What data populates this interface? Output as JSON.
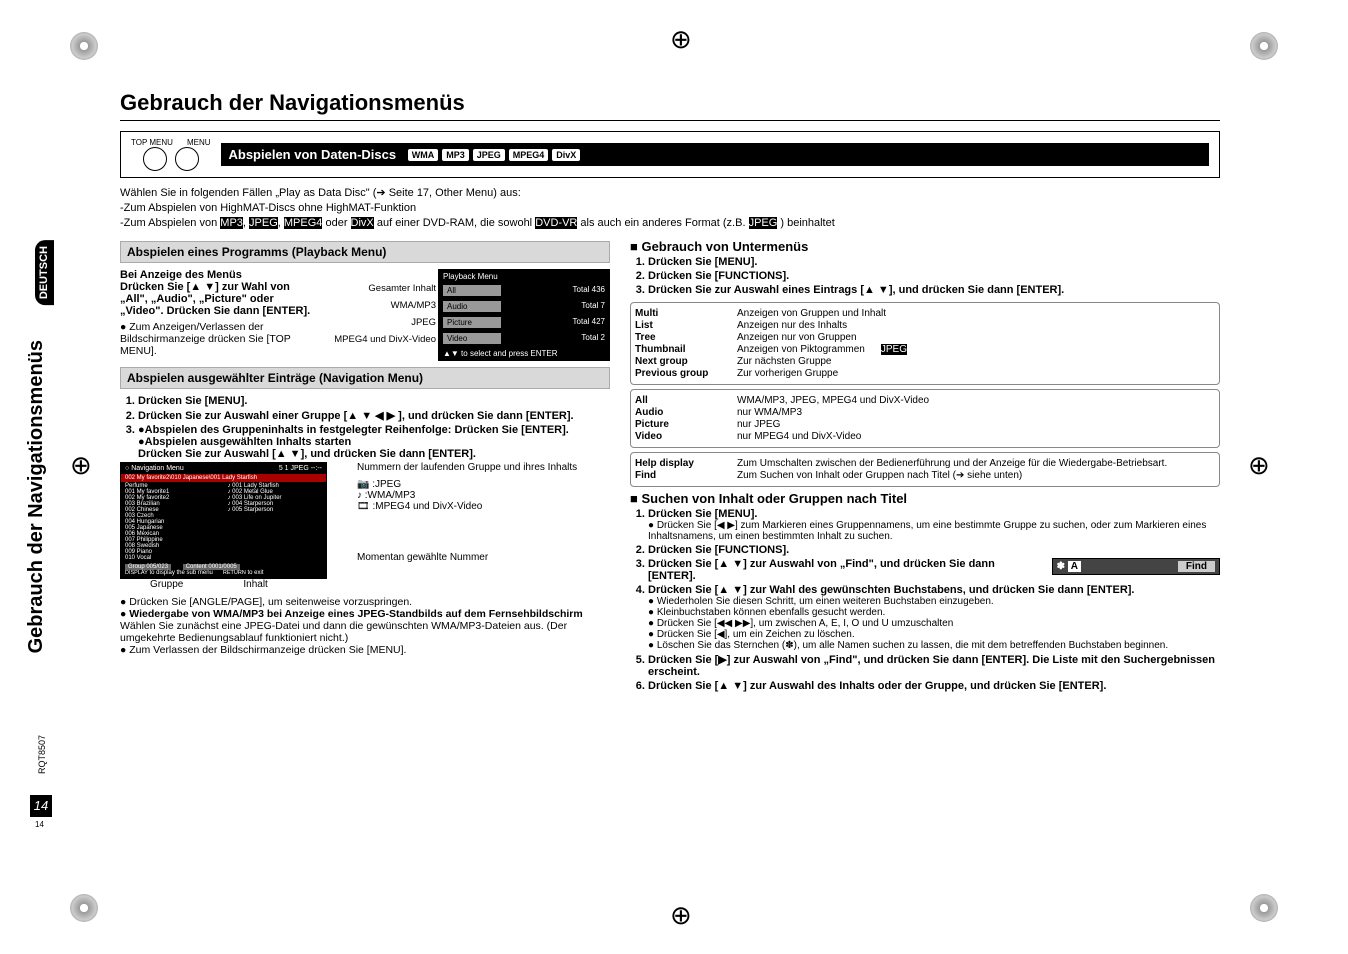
{
  "header": {
    "title": "Gebrauch der Navigationsmenüs",
    "strip": "Abspielen von Daten-Discs",
    "tags": [
      "WMA",
      "MP3",
      "JPEG",
      "MPEG4",
      "DivX"
    ],
    "topmenu": "TOP MENU",
    "menu": "MENU"
  },
  "intro": {
    "line1": "Wählen Sie in folgenden Fällen „Play as Data Disc\" (➔ Seite 17, Other Menu) aus:",
    "line2": "-Zum Abspielen von HighMAT-Discs ohne HighMAT-Funktion",
    "line3a": "-Zum Abspielen von ",
    "line3_tags": [
      "MP3",
      "JPEG",
      "MPEG4"
    ],
    "or": " oder ",
    "line3_tag2": "DivX",
    "line3b": " auf einer DVD-RAM, die sowohl ",
    "dvdvr": "DVD-VR",
    "line3c": " als auch ein anderes Format (z.B. ",
    "jpeg2": "JPEG",
    "line3d": ") beinhaltet"
  },
  "side": {
    "vertical": "Gebrauch der Navigationsmenüs",
    "deutsch": "DEUTSCH",
    "rqt": "RQT8507",
    "page": "14",
    "page_small": "14"
  },
  "left": {
    "sec1": "Abspielen eines Programms (Playback Menu)",
    "menus_shown": "Bei Anzeige des Menüs",
    "press": "Drücken Sie [▲ ▼] zur Wahl von „All\", „Audio\", „Picture\" oder „Video\". Drücken Sie dann [ENTER].",
    "bullet1": "● Zum Anzeigen/Verlassen der Bildschirmanzeige drücken Sie [TOP MENU].",
    "labels": {
      "all": "Gesamter Inhalt",
      "wma": "WMA/MP3",
      "jpeg": "JPEG",
      "mpeg4": "MPEG4 und DivX-Video"
    },
    "pbmenu": {
      "title": "Playback Menu",
      "rows": [
        {
          "l": "All",
          "r": "Total 436"
        },
        {
          "l": "Audio",
          "r": "Total 7"
        },
        {
          "l": "Picture",
          "r": "Total 427"
        },
        {
          "l": "Video",
          "r": "Total 2"
        }
      ],
      "foot": "▲▼ to select and press ENTER"
    },
    "sec2": "Abspielen ausgewählter Einträge (Navigation Menu)",
    "steps": [
      "Drücken Sie [MENU].",
      "Drücken Sie zur Auswahl einer Gruppe [▲ ▼ ◀ ▶ ], und drücken Sie dann [ENTER].",
      "●Abspielen des Gruppeninhalts in festgelegter Reihenfolge: Drücken Sie [ENTER].\n●Abspielen ausgewählten Inhalts starten\nDrücken Sie zur Auswahl [▲ ▼], und drücken Sie dann [ENTER]."
    ],
    "caption_num": "Nummern der laufenden Gruppe und ihres Inhalts",
    "legend": {
      "jpeg": ":JPEG",
      "wma": ":WMA/MP3",
      "mpeg4": ":MPEG4 und DivX-Video"
    },
    "navmenu": {
      "title": "Navigation Menu",
      "path": "002 My favorite2\\010 Japanese\\001 Lady Starfish",
      "left_items": [
        "Perfume",
        "001 My favorite1",
        "002 My favorite2",
        "003 Brazilian",
        "002 Chinese",
        "003 Czech",
        "004 Hungarian",
        "005 Japanese",
        "006 Mexican",
        "007 Philippine",
        "008 Swedish",
        "009 Piano",
        "010 Vocal"
      ],
      "right_items": [
        "001 Lady Starfish",
        "002 Metal Glue",
        "003 Life on Jupiter",
        "004 Starperson",
        "005 Starperson"
      ],
      "footer_l": "Group    005/023",
      "footer_r": "Content   0001/0005",
      "footer_hint": "to display the sub menu",
      "footer_exit": "to exit"
    },
    "caption_current": "Momentan gewählte Nummer",
    "group": "Gruppe",
    "content": "Inhalt",
    "foot1": "● Drücken Sie [ANGLE/PAGE], um seitenweise vorzuspringen.",
    "foot2_head": "● Wiedergabe von WMA/MP3 bei Anzeige eines JPEG-Standbilds auf dem Fernsehbildschirm",
    "foot2_body": "Wählen Sie zunächst eine JPEG-Datei und dann die gewünschten WMA/MP3-Dateien aus. (Der umgekehrte Bedienungsablauf funktioniert nicht.)",
    "foot3": "● Zum Verlassen der Bildschirmanzeige drücken Sie [MENU]."
  },
  "right": {
    "title1": "■ Gebrauch von Untermenüs",
    "steps1": [
      "Drücken Sie [MENU].",
      "Drücken Sie [FUNCTIONS].",
      "Drücken Sie zur Auswahl eines Eintrags [▲ ▼], und drücken Sie dann [ENTER]."
    ],
    "group1": [
      {
        "k": "Multi",
        "v": "Anzeigen von Gruppen und Inhalt"
      },
      {
        "k": "List",
        "v": "Anzeigen nur des Inhalts"
      },
      {
        "k": "Tree",
        "v": "Anzeigen nur von Gruppen"
      },
      {
        "k": "Thumbnail",
        "v": "Anzeigen von Piktogrammen",
        "tag": "JPEG"
      },
      {
        "k": "Next group",
        "v": "Zur nächsten Gruppe"
      },
      {
        "k": "Previous group",
        "v": "Zur vorherigen Gruppe"
      }
    ],
    "group2": [
      {
        "k": "All",
        "v": "WMA/MP3, JPEG, MPEG4 und DivX-Video"
      },
      {
        "k": "Audio",
        "v": "nur WMA/MP3"
      },
      {
        "k": "Picture",
        "v": "nur JPEG"
      },
      {
        "k": "Video",
        "v": "nur MPEG4 und DivX-Video"
      }
    ],
    "group3": [
      {
        "k": "Help display",
        "v": "Zum Umschalten zwischen der Bedienerführung und der Anzeige für die Wiedergabe-Betriebsart."
      },
      {
        "k": "Find",
        "v": "Zum Suchen von Inhalt oder Gruppen nach Titel (➔ siehe unten)"
      }
    ],
    "title2": "■ Suchen von Inhalt oder Gruppen nach Titel",
    "s2steps": [
      "Drücken Sie [MENU].",
      "Drücken Sie [FUNCTIONS].",
      "Drücken Sie [▲ ▼] zur Auswahl von „Find\", und drücken Sie dann [ENTER].",
      "Drücken Sie [▲ ▼] zur Wahl des gewünschten Buchstabens, und drücken Sie dann [ENTER].",
      "Drücken Sie [▶] zur Auswahl von „Find\", und drücken Sie dann [ENTER]. Die Liste mit den Suchergebnissen erscheint.",
      "Drücken Sie [▲ ▼] zur Auswahl des Inhalts oder der Gruppe, und drücken Sie [ENTER]."
    ],
    "s2_1_bullet": "● Drücken Sie [◀ ▶] zum Markieren eines Gruppennamens, um eine bestimmte Gruppe zu suchen, oder zum Markieren eines Inhaltsnamens, um einen bestimmten Inhalt zu suchen.",
    "s2_4_bullets": [
      "● Wiederholen Sie diesen Schritt, um einen weiteren Buchstaben einzugeben.",
      "● Kleinbuchstaben können ebenfalls gesucht werden.",
      "● Drücken Sie [◀◀ ▶▶], um zwischen A, E, I, O und U umzuschalten",
      "● Drücken Sie [◀], um ein Zeichen zu löschen.",
      "● Löschen Sie das Sternchen (✽), um alle Namen suchen zu lassen, die mit dem betreffenden Buchstaben beginnen."
    ],
    "findbox": {
      "star": "✽",
      "a": "A",
      "find": "Find"
    }
  }
}
